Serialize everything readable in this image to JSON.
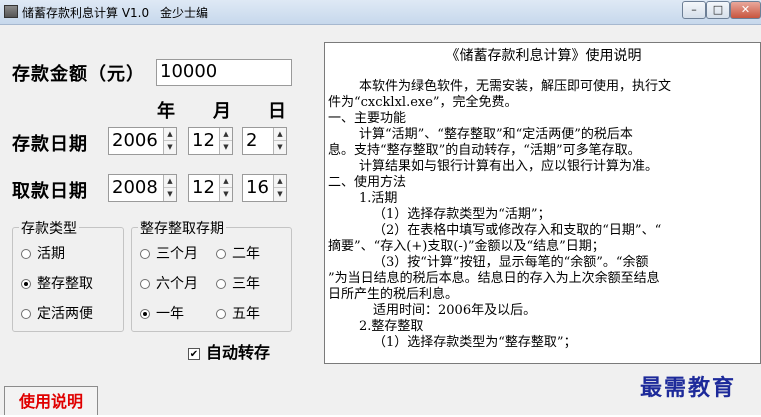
{
  "window": {
    "title": "储蓄存款利息计算 V1.0",
    "author": "金少士编",
    "min_symbol": "–",
    "max_symbol": "□",
    "close_symbol": "✕"
  },
  "deposit": {
    "amount_label": "存款金额（元）",
    "amount_value": "10000"
  },
  "date_headers": {
    "year": "年",
    "month": "月",
    "day": "日"
  },
  "deposit_date": {
    "label": "存款日期",
    "year": "2006",
    "month": "12",
    "day": "2"
  },
  "withdraw_date": {
    "label": "取款日期",
    "year": "2008",
    "month": "12",
    "day": "16"
  },
  "deposit_type": {
    "title": "存款类型",
    "options": [
      "活期",
      "整存整取",
      "定活两便"
    ],
    "selected": "整存整取"
  },
  "fixed_term": {
    "title": "整存整取存期",
    "options": [
      "三个月",
      "二年",
      "六个月",
      "三年",
      "一年",
      "五年"
    ],
    "selected": "一年"
  },
  "auto_renew": {
    "label": "自动转存",
    "checked": true
  },
  "help_button": {
    "label": "使用说明"
  },
  "help_text": {
    "title": "《储蓄存款利息计算》使用说明",
    "lines": [
      "本软件为绿色软件，无需安装，解压即可使用，执行文",
      "件为“cxcklxl.exe”，完全免费。",
      "一、主要功能",
      "计算“活期”、“整存整取”和“定活两便”的税后本",
      "息。支持“整存整取”的自动转存，“活期”可多笔存取。",
      "计算结果如与银行计算有出入，应以银行计算为准。",
      "二、使用方法",
      "1.活期",
      "（1）选择存款类型为“活期”；",
      "（2）在表格中填写或修改存入和支取的“日期”、“",
      "摘要”、“存入(+)支取(-)”金额以及“结息”日期；",
      "（3）按“计算”按钮，显示每笔的“余额”。“余额",
      "”为当日结息的税后本息。结息日的存入为上次余额至结息",
      "日所产生的税后利息。",
      "适用时间：2006年及以后。",
      "2.整存整取",
      "（1）选择存款类型为“整存整取”；"
    ]
  },
  "watermark": "最需教育",
  "colors": {
    "help_button_text": "#e00000",
    "brand": "#1d2a9a"
  }
}
